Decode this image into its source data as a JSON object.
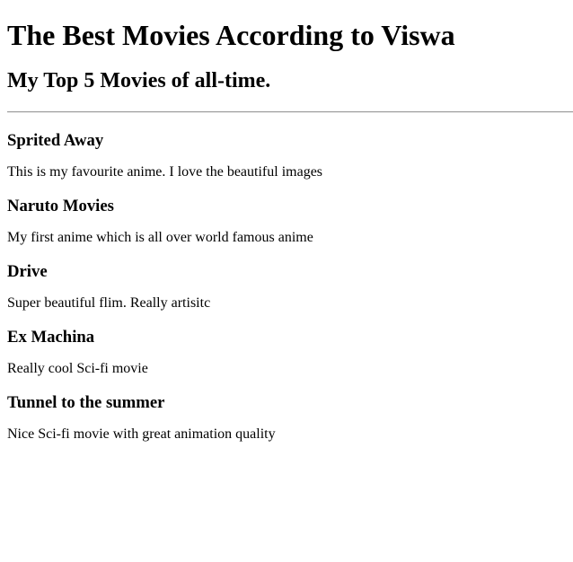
{
  "page": {
    "title": "The Best Movies According to Viswa",
    "subtitle": "My Top 5 Movies of all-time."
  },
  "movies": [
    {
      "name": "Sprited Away",
      "description": "This is my favourite anime. I love the beautiful images"
    },
    {
      "name": "Naruto Movies",
      "description": "My first anime which is all over world famous anime"
    },
    {
      "name": "Drive",
      "description": "Super beautiful flim. Really artisitc"
    },
    {
      "name": "Ex Machina",
      "description": "Really cool Sci-fi movie"
    },
    {
      "name": "Tunnel to the summer",
      "description": "Nice Sci-fi movie with great animation quality"
    }
  ]
}
